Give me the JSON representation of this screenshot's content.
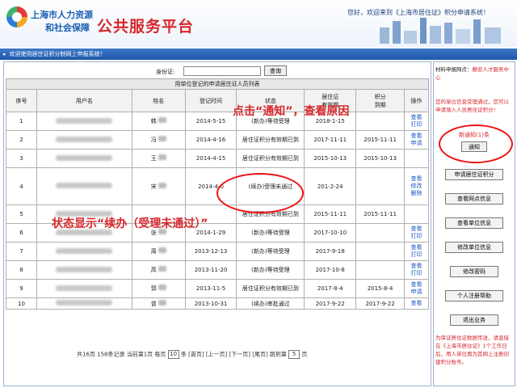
{
  "header": {
    "org_line1": "上海市人力资源",
    "org_line2": "和社会保障",
    "platform_title": "公共服务平台",
    "welcome": "您好，欢迎来到《上海市居住证》积分申请系统！"
  },
  "nav": {
    "text": "欢迎使用居住证积分制网上申报系统！"
  },
  "search": {
    "label": "身份证:",
    "input_value": "",
    "button": "查询"
  },
  "table": {
    "title": "用单位登记的申请居住证人员列表",
    "columns": [
      "序号",
      "用户名",
      "姓名",
      "登记时间",
      "状态",
      "居住证\n有效期",
      "积分\n到期",
      "操作"
    ],
    "rows": [
      {
        "no": "1",
        "name": "韩",
        "date": "2014-5-15",
        "status": "(新办)等待受理",
        "expiry": "2018-1-15",
        "points": "",
        "ops": [
          "查看",
          "打印"
        ]
      },
      {
        "no": "2",
        "name": "冯",
        "date": "2014-4-16",
        "status": "居住证积分有效期已到",
        "expiry": "2017-11-11",
        "points": "2015-11-11",
        "ops": [
          "查看",
          "申请"
        ]
      },
      {
        "no": "3",
        "name": "王",
        "date": "2014-4-15",
        "status": "居住证积分有效期已到",
        "expiry": "2015-10-13",
        "points": "2015-10-13",
        "ops": []
      },
      {
        "no": "4",
        "name": "宋",
        "date": "2014-4-0",
        "status": "(续办)受理未通过",
        "expiry": "201-2-24",
        "points": "",
        "ops": [
          "查看",
          "修改",
          "删除"
        ]
      },
      {
        "no": "5",
        "name": "",
        "date": "",
        "status": "居住证积分有效期已到",
        "expiry": "2015-11-11",
        "points": "2015-11-11",
        "ops": []
      },
      {
        "no": "6",
        "name": "张",
        "date": "2014-1-29",
        "status": "(新办)等待受理",
        "expiry": "2017-10-10",
        "points": "",
        "ops": [
          "查看",
          "打印"
        ]
      },
      {
        "no": "7",
        "name": "周",
        "date": "2013-12-13",
        "status": "(新办)等待受理",
        "expiry": "2017-9-18",
        "points": "",
        "ops": [
          "查看",
          "打印"
        ]
      },
      {
        "no": "8",
        "name": "高",
        "date": "2013-11-20",
        "status": "(新办)等待受理",
        "expiry": "2017-10-8",
        "points": "",
        "ops": [
          "查看",
          "打印"
        ]
      },
      {
        "no": "9",
        "name": "郭",
        "date": "2013-11-5",
        "status": "居住证积分有效期已到",
        "expiry": "2017-8-4",
        "points": "2015-8-4",
        "ops": [
          "查看",
          "申请"
        ]
      },
      {
        "no": "10",
        "name": "曾",
        "date": "2013-10-31",
        "status": "(续办)审批通过",
        "expiry": "2017-9-22",
        "points": "2017-9-22",
        "ops": [
          "查看"
        ]
      }
    ]
  },
  "pager": {
    "summary": "共16页 158条记录 当前第1页 每页",
    "per_page": "10",
    "unit": "条",
    "first": "[首页]",
    "prev": "[上一页]",
    "next": "[下一页]",
    "last": "[尾页]",
    "jump_label": "跳到第",
    "jump_value": "5",
    "page_unit": "页"
  },
  "sidebar": {
    "org_label": "材料申报网点：",
    "org_value": "静安人才服务中心",
    "notice": "您的单位信息受理通过，您可以申请填入人员居住证积分！",
    "notify_count": "新通知(1)条",
    "notify_button": "通知",
    "buttons": [
      "申请居住证积分",
      "查看网点信息",
      "查看单位信息",
      "修改单位信息",
      "修改密码",
      "个人注册帮助",
      "退出业务"
    ],
    "footer": "为保证居住证数据传送，请直接在《上海市居住证》1个工作日后，用人单位再为其网上注册创建积分账号。"
  },
  "annotations": {
    "click_notice": "点击“通知”，查看原因",
    "status_shows": "状态显示“续办（受理未通过）”"
  }
}
